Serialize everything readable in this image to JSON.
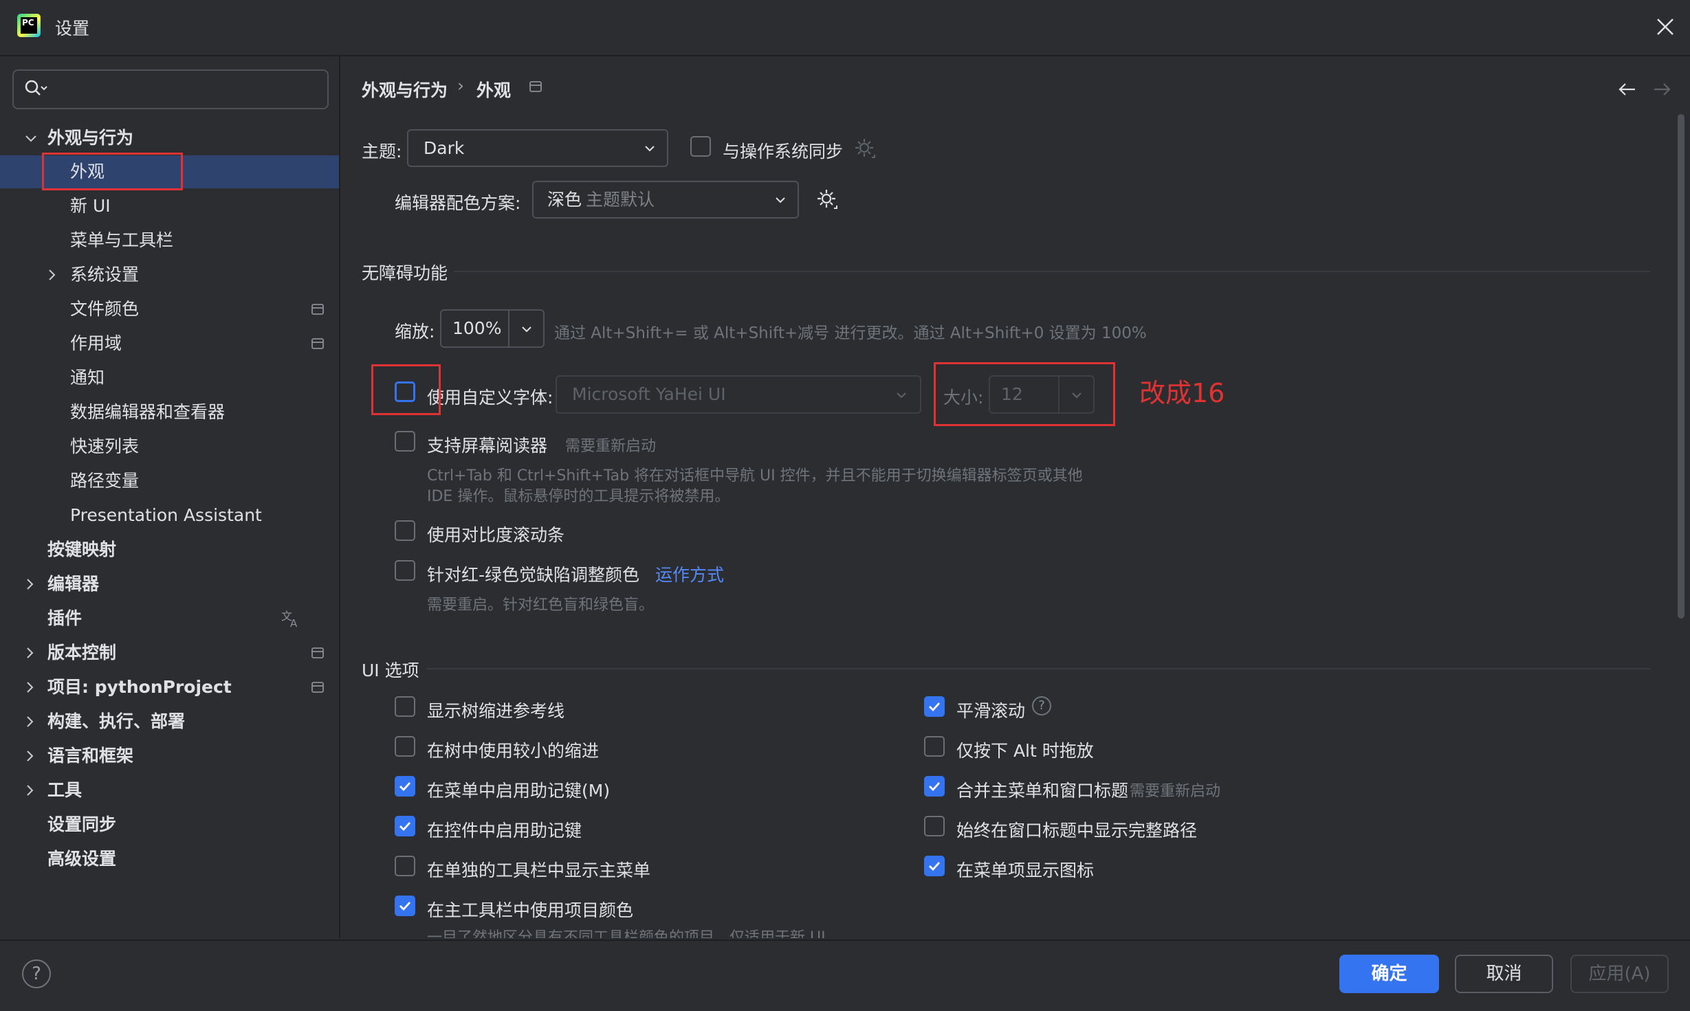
{
  "window": {
    "title": "设置"
  },
  "search": {
    "placeholder": ""
  },
  "sidebar": {
    "items": [
      {
        "label": "外观与行为",
        "bold": true,
        "expanded": true
      },
      {
        "label": "外观",
        "selected": true
      },
      {
        "label": "新 UI"
      },
      {
        "label": "菜单与工具栏"
      },
      {
        "label": "系统设置",
        "collapsed": true
      },
      {
        "label": "文件颜色",
        "icon": "project-level-icon"
      },
      {
        "label": "作用域",
        "icon": "project-level-icon"
      },
      {
        "label": "通知"
      },
      {
        "label": "数据编辑器和查看器"
      },
      {
        "label": "快速列表"
      },
      {
        "label": "路径变量"
      },
      {
        "label": "Presentation Assistant"
      },
      {
        "label": "按键映射",
        "bold": true
      },
      {
        "label": "编辑器",
        "bold": true,
        "collapsed": true
      },
      {
        "label": "插件",
        "bold": true,
        "icon": "translate-icon"
      },
      {
        "label": "版本控制",
        "bold": true,
        "collapsed": true,
        "icon": "project-level-icon"
      },
      {
        "label": "项目: pythonProject",
        "bold": true,
        "collapsed": true,
        "icon": "project-level-icon"
      },
      {
        "label": "构建、执行、部署",
        "bold": true,
        "collapsed": true
      },
      {
        "label": "语言和框架",
        "bold": true,
        "collapsed": true
      },
      {
        "label": "工具",
        "bold": true,
        "collapsed": true
      },
      {
        "label": "设置同步",
        "bold": true
      },
      {
        "label": "高级设置",
        "bold": true
      }
    ]
  },
  "breadcrumb": {
    "parent": "外观与行为",
    "separator": "›",
    "current": "外观"
  },
  "theme": {
    "label": "主题:",
    "value": "Dark",
    "sync_label": "与操作系统同步",
    "sync_checked": false
  },
  "editor_scheme": {
    "label": "编辑器配色方案:",
    "value": "深色",
    "value_hint": "主题默认"
  },
  "accessibility": {
    "title": "无障碍功能",
    "zoom_label": "缩放:",
    "zoom_value": "100%",
    "zoom_hint": "通过 Alt+Shift+= 或 Alt+Shift+减号 进行更改。通过 Alt+Shift+0 设置为 100%",
    "custom_font_label": "使用自定义字体:",
    "custom_font_checked": false,
    "font_value": "Microsoft YaHei UI",
    "size_label": "大小:",
    "size_value": "12",
    "screen_reader_label": "支持屏幕阅读器",
    "screen_reader_hint": "需要重新启动",
    "screen_reader_desc_1": "Ctrl+Tab 和 Ctrl+Shift+Tab 将在对话框中导航 UI 控件，并且不能用于切换编辑器标签页或其他",
    "screen_reader_desc_2": "IDE 操作。鼠标悬停时的工具提示将被禁用。",
    "contrast_scrollbars_label": "使用对比度滚动条",
    "color_blind_label": "针对红-绿色觉缺陷调整颜色",
    "color_blind_link": "运作方式",
    "color_blind_hint": "需要重启。针对红色盲和绿色盲。"
  },
  "annotation": {
    "text": "改成16",
    "color": "#e03232"
  },
  "ui_options": {
    "title": "UI 选项",
    "left": [
      {
        "label": "显示树缩进参考线",
        "checked": false
      },
      {
        "label": "在树中使用较小的缩进",
        "checked": false
      },
      {
        "label": "在菜单中启用助记键(M)",
        "checked": true
      },
      {
        "label": "在控件中启用助记键",
        "checked": true
      },
      {
        "label": "在单独的工具栏中显示主菜单",
        "checked": false
      },
      {
        "label": "在主工具栏中使用项目颜色",
        "checked": true
      }
    ],
    "right": [
      {
        "label": "平滑滚动",
        "checked": true,
        "help": true
      },
      {
        "label": "仅按下 Alt 时拖放",
        "checked": false
      },
      {
        "label": "合并主菜单和窗口标题",
        "checked": true,
        "hint": "需要重新启动"
      },
      {
        "label": "始终在窗口标题中显示完整路径",
        "checked": false
      },
      {
        "label": "在菜单项显示图标",
        "checked": true
      }
    ],
    "cut_off_text": "一目了然地区分具有不同工具栏颜色的项目。仅适用于新 UI"
  },
  "footer": {
    "help": "?",
    "ok_label": "确定",
    "cancel_label": "取消",
    "apply_label": "应用(A)"
  },
  "colors": {
    "background": "#2b2d30",
    "selection": "#2e436e",
    "accent": "#3574f0",
    "link": "#548af7",
    "annotation_red": "#e03232"
  }
}
